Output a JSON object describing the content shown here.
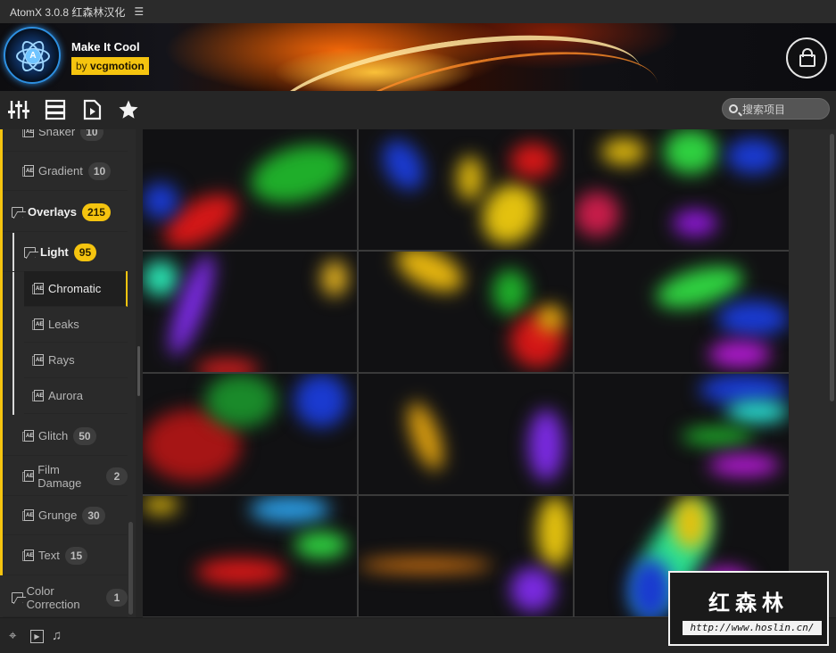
{
  "titlebar": {
    "app_title": "AtomX 3.0.8 红森林汉化",
    "menu_icon": "hamburger-icon"
  },
  "banner": {
    "pack_title": "Make It Cool",
    "by_label": "by",
    "author": "vcgmotion",
    "cart_icon": "shopping-bag-icon"
  },
  "toolbar": {
    "icons": [
      "sliders-icon",
      "list-icon",
      "video-file-icon",
      "star-icon"
    ],
    "search_placeholder": "搜索项目"
  },
  "sidebar": {
    "items": [
      {
        "label": "Shaker",
        "count": "10"
      },
      {
        "label": "Gradient",
        "count": "10"
      },
      {
        "label": "Overlays",
        "count": "215"
      },
      {
        "label": "Light",
        "count": "95"
      },
      {
        "label": "Chromatic"
      },
      {
        "label": "Leaks"
      },
      {
        "label": "Rays"
      },
      {
        "label": "Aurora"
      },
      {
        "label": "Glitch",
        "count": "50"
      },
      {
        "label": "Film Damage",
        "count": "2"
      },
      {
        "label": "Grunge",
        "count": "30"
      },
      {
        "label": "Text",
        "count": "15"
      },
      {
        "label": "Color Correction",
        "count": "1"
      }
    ]
  },
  "accent_color": "#f5c40f",
  "grid": {
    "rows": 4,
    "columns": 3
  },
  "bottombar": {
    "icons": [
      "crosshair-icon",
      "play-icon",
      "music-note-icon"
    ]
  },
  "watermark": {
    "cn": "红森林",
    "url": "http://www.hoslin.cn/"
  }
}
